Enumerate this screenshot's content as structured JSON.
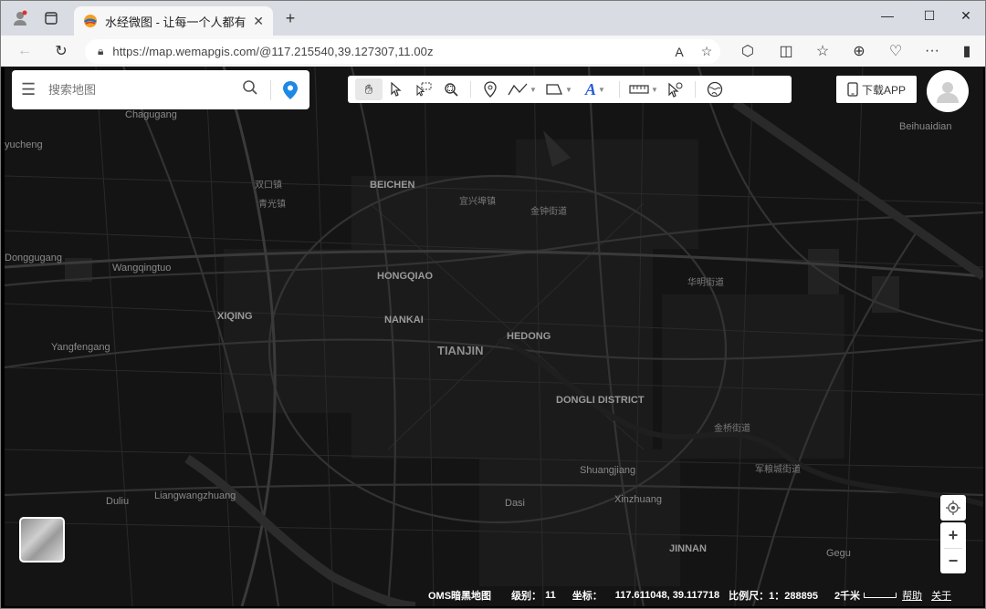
{
  "browser": {
    "tab_title": "水经微图 - 让每一个人都有自己的地图",
    "url": "https://map.wemapgis.com/@117.215540,39.127307,11.00z"
  },
  "search": {
    "placeholder": "搜索地图"
  },
  "download_label": "下载APP",
  "map_labels": [
    {
      "text": "Chagugang",
      "style": "plain"
    },
    {
      "text": "yucheng",
      "style": "plain"
    },
    {
      "text": "双口镇",
      "style": "cn"
    },
    {
      "text": "青光镇",
      "style": "cn"
    },
    {
      "text": "BEICHEN",
      "style": "b"
    },
    {
      "text": "宜兴埠镇",
      "style": "cn"
    },
    {
      "text": "金钟街道",
      "style": "cn"
    },
    {
      "text": "Beihuaidian",
      "style": "plain"
    },
    {
      "text": "Donggugang",
      "style": "plain"
    },
    {
      "text": "Wangqingtuo",
      "style": "plain"
    },
    {
      "text": "HONGQIAO",
      "style": "b"
    },
    {
      "text": "华明街道",
      "style": "cn"
    },
    {
      "text": "XIQING",
      "style": "b"
    },
    {
      "text": "NANKAI",
      "style": "b"
    },
    {
      "text": "HEDONG",
      "style": "b"
    },
    {
      "text": "Yangfengang",
      "style": "plain"
    },
    {
      "text": "TIANJIN",
      "style": "big"
    },
    {
      "text": "DONGLI DISTRICT",
      "style": "b"
    },
    {
      "text": "金桥街道",
      "style": "cn"
    },
    {
      "text": "Shuangjiang",
      "style": "plain"
    },
    {
      "text": "军粮城街道",
      "style": "cn"
    },
    {
      "text": "Duliu",
      "style": "plain"
    },
    {
      "text": "Liangwangzhuang",
      "style": "plain"
    },
    {
      "text": "Dasi",
      "style": "plain"
    },
    {
      "text": "Xinzhuang",
      "style": "plain"
    },
    {
      "text": "JINNAN",
      "style": "b"
    },
    {
      "text": "Gegu",
      "style": "plain"
    }
  ],
  "status": {
    "basemap": "OMS暗黑地图",
    "level_label": "级别：",
    "level": "11",
    "coord_label": "坐标：",
    "coord": "117.611048, 39.117718",
    "scale_label": "比例尺：",
    "scale": "1：288895",
    "scalebar": "2千米",
    "help": "帮助",
    "about": "关于"
  },
  "zoom": {
    "in": "+",
    "out": "−"
  }
}
